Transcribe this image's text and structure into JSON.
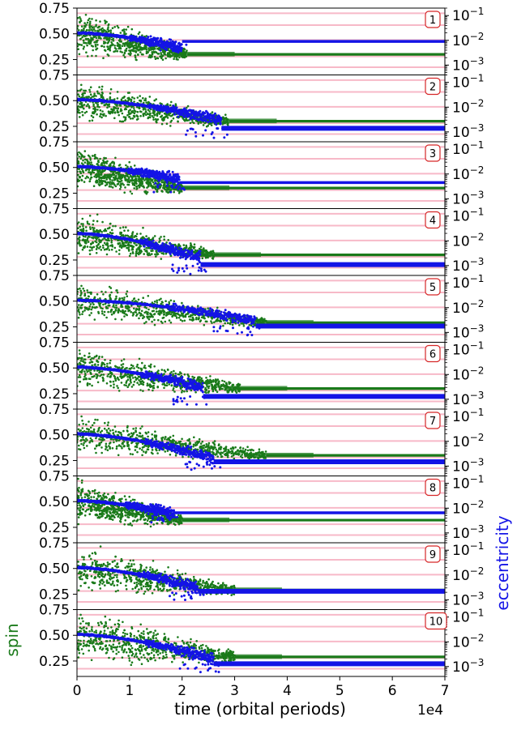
{
  "chart_data": {
    "type": "scatter",
    "panel_count": 10,
    "x_axis": {
      "label": "time (orbital periods)",
      "multiplier_label": "1e4",
      "range": [
        0,
        7
      ],
      "ticks": [
        0,
        1,
        2,
        3,
        4,
        5,
        6,
        7
      ]
    },
    "left_axis": {
      "label": "spin",
      "label_color": "#1a7a1a",
      "range": [
        0.1,
        0.75
      ],
      "ticks": [
        0.75,
        0.5,
        0.25
      ],
      "tick_labels": [
        "0.75",
        "0.50",
        "0.25"
      ]
    },
    "right_axis": {
      "label": "eccentricity",
      "label_color": "#1414e6",
      "scale": "log",
      "range": [
        0.0004,
        0.2
      ],
      "ticks": [
        0.1,
        0.01,
        0.001
      ],
      "tick_base": "10",
      "tick_exponents": [
        "−1",
        "−2",
        "−3"
      ]
    },
    "reference_lines": {
      "color": "#f7b9c8",
      "spin_values": [
        0.175,
        0.28,
        0.44,
        0.585,
        0.7
      ]
    },
    "series_colors": {
      "spin": "#1a7a1a",
      "eccentricity": "#1414e6"
    },
    "panels": [
      {
        "label": "1",
        "spin_final": 0.3,
        "ecc_start": 0.02,
        "ecc_knee": 0.005,
        "ecc_final": 0.009,
        "settle": 2.1,
        "ecc_settle": 2.0,
        "spread": 0.22
      },
      {
        "label": "2",
        "spin_final": 0.3,
        "ecc_start": 0.02,
        "ecc_knee": 0.003,
        "ecc_final": 0.0014,
        "settle": 2.9,
        "ecc_settle": 2.75,
        "spread": 0.2
      },
      {
        "label": "3",
        "spin_final": 0.3,
        "ecc_start": 0.02,
        "ecc_knee": 0.006,
        "ecc_final": 0.0045,
        "settle": 2.0,
        "ecc_settle": 1.95,
        "spread": 0.22
      },
      {
        "label": "4",
        "spin_final": 0.3,
        "ecc_start": 0.02,
        "ecc_knee": 0.002,
        "ecc_final": 0.0011,
        "settle": 2.6,
        "ecc_settle": 2.35,
        "spread": 0.2
      },
      {
        "label": "5",
        "spin_final": 0.29,
        "ecc_start": 0.02,
        "ecc_knee": 0.003,
        "ecc_final": 0.0018,
        "settle": 3.6,
        "ecc_settle": 3.4,
        "spread": 0.18
      },
      {
        "label": "6",
        "spin_final": 0.3,
        "ecc_start": 0.02,
        "ecc_knee": 0.003,
        "ecc_final": 0.0013,
        "settle": 3.1,
        "ecc_settle": 2.4,
        "spread": 0.2
      },
      {
        "label": "7",
        "spin_final": 0.3,
        "ecc_start": 0.02,
        "ecc_knee": 0.002,
        "ecc_final": 0.0015,
        "settle": 3.6,
        "ecc_settle": 2.6,
        "spread": 0.18
      },
      {
        "label": "8",
        "spin_final": 0.32,
        "ecc_start": 0.02,
        "ecc_knee": 0.006,
        "ecc_final": 0.0065,
        "settle": 2.0,
        "ecc_settle": 1.85,
        "spread": 0.2
      },
      {
        "label": "9",
        "spin_final": 0.29,
        "ecc_start": 0.02,
        "ecc_knee": 0.003,
        "ecc_final": 0.0022,
        "settle": 3.0,
        "ecc_settle": 2.3,
        "spread": 0.22
      },
      {
        "label": "10",
        "spin_final": 0.29,
        "ecc_start": 0.02,
        "ecc_knee": 0.002,
        "ecc_final": 0.0013,
        "settle": 3.0,
        "ecc_settle": 2.6,
        "spread": 0.24
      }
    ]
  }
}
